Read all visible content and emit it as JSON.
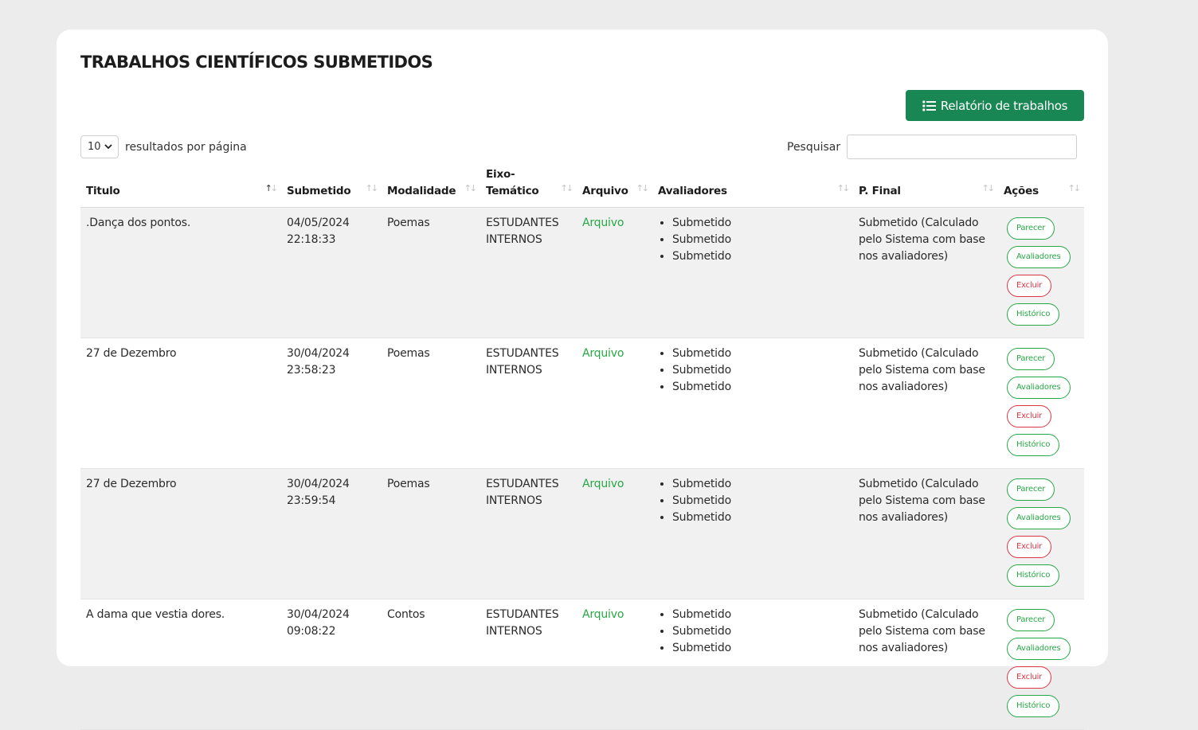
{
  "page": {
    "title": "TRABALHOS CIENTÍFICOS SUBMETIDOS",
    "report_button": "Relatório de trabalhos",
    "report_icon": "list-icon",
    "length": {
      "value": "10",
      "suffix": "resultados por página"
    },
    "search": {
      "label": "Pesquisar",
      "value": ""
    }
  },
  "colors": {
    "primary": "#198754",
    "link": "#28a745",
    "danger": "#dc3545"
  },
  "table": {
    "headers": [
      {
        "label": "Titulo",
        "sort": "asc"
      },
      {
        "label": "Submetido",
        "sort": "none"
      },
      {
        "label": "Modalidade",
        "sort": "none"
      },
      {
        "label": "Eixo-Temático",
        "sort": "none"
      },
      {
        "label": "Arquivo",
        "sort": "none"
      },
      {
        "label": "Avaliadores",
        "sort": "none"
      },
      {
        "label": "P. Final",
        "sort": "none"
      },
      {
        "label": "Ações",
        "sort": "none"
      }
    ],
    "rows": [
      {
        "titulo": ".Dança dos pontos.",
        "data": "04/05/2024",
        "hora": "22:18:33",
        "modalidade": "Poemas",
        "eixo_1": "ESTUDANTES",
        "eixo_2": "INTERNOS",
        "arquivo": "Arquivo",
        "avaliadores": [
          "Submetido",
          "Submetido",
          "Submetido"
        ],
        "final": "Submetido (Calculado pelo Sistema com base nos avaliadores)",
        "acoes": [
          "Parecer",
          "Avaliadores",
          "Excluir",
          "Histórico"
        ]
      },
      {
        "titulo": "27 de Dezembro",
        "data": "30/04/2024",
        "hora": "23:58:23",
        "modalidade": "Poemas",
        "eixo_1": "ESTUDANTES",
        "eixo_2": "INTERNOS",
        "arquivo": "Arquivo",
        "avaliadores": [
          "Submetido",
          "Submetido",
          "Submetido"
        ],
        "final": "Submetido (Calculado pelo Sistema com base nos avaliadores)",
        "acoes": [
          "Parecer",
          "Avaliadores",
          "Excluir",
          "Histórico"
        ]
      },
      {
        "titulo": "27 de Dezembro",
        "data": "30/04/2024",
        "hora": "23:59:54",
        "modalidade": "Poemas",
        "eixo_1": "ESTUDANTES",
        "eixo_2": "INTERNOS",
        "arquivo": "Arquivo",
        "avaliadores": [
          "Submetido",
          "Submetido",
          "Submetido"
        ],
        "final": "Submetido (Calculado pelo Sistema com base nos avaliadores)",
        "acoes": [
          "Parecer",
          "Avaliadores",
          "Excluir",
          "Histórico"
        ]
      },
      {
        "titulo": "A dama que vestia dores.",
        "data": "30/04/2024",
        "hora": "09:08:22",
        "modalidade": "Contos",
        "eixo_1": "ESTUDANTES",
        "eixo_2": "INTERNOS",
        "arquivo": "Arquivo",
        "avaliadores": [
          "Submetido",
          "Submetido",
          "Submetido"
        ],
        "final": "Submetido (Calculado pelo Sistema com base nos avaliadores)",
        "acoes": [
          "Parecer",
          "Avaliadores",
          "Excluir",
          "Histórico"
        ]
      }
    ]
  }
}
